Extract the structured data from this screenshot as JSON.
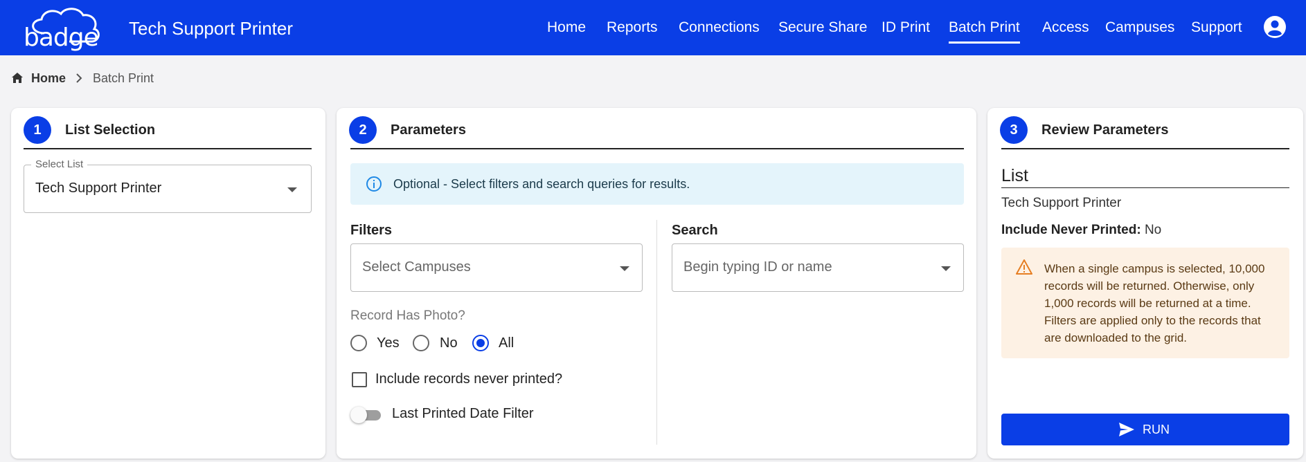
{
  "header": {
    "logo_text": "badge",
    "app_title": "Tech Support Printer",
    "nav": [
      {
        "label": "Home"
      },
      {
        "label": "Reports"
      },
      {
        "label": "Connections"
      },
      {
        "label": "Secure Share"
      },
      {
        "label": "ID Print"
      },
      {
        "label": "Batch Print",
        "active": true
      },
      {
        "label": "Access"
      },
      {
        "label": "Campuses"
      },
      {
        "label": "Support"
      }
    ],
    "user_icon": "account-circle-icon"
  },
  "breadcrumb": {
    "home": "Home",
    "current": "Batch Print"
  },
  "step1": {
    "number": "1",
    "title": "List Selection",
    "select_label": "Select List",
    "select_value": "Tech Support Printer"
  },
  "step2": {
    "number": "2",
    "title": "Parameters",
    "info_text": "Optional - Select filters and search queries for results.",
    "filters_title": "Filters",
    "campuses_placeholder": "Select Campuses",
    "search_title": "Search",
    "search_placeholder": "Begin typing ID or name",
    "photo_question": "Record Has Photo?",
    "photo_options": [
      {
        "label": "Yes",
        "checked": false
      },
      {
        "label": "No",
        "checked": false
      },
      {
        "label": "All",
        "checked": true
      }
    ],
    "never_printed_label": "Include records never printed?",
    "never_printed_checked": false,
    "last_printed_label": "Last Printed Date Filter",
    "last_printed_on": false
  },
  "step3": {
    "number": "3",
    "title": "Review Parameters",
    "list_heading": "List",
    "list_value": "Tech Support Printer",
    "include_never_printed_key": "Include Never Printed:",
    "include_never_printed_value": "No",
    "warning": "When a single campus is selected, 10,000 records will be returned. Otherwise, only 1,000 records will be returned at a time. Filters are applied only to the records that are downloaded to the grid.",
    "run_label": "RUN"
  },
  "colors": {
    "primary": "#0a3ee6",
    "info_bg": "#e4f4fb",
    "warning_bg": "#fdf1e4",
    "warning_icon": "#e67e22",
    "info_icon": "#1e88e5"
  }
}
